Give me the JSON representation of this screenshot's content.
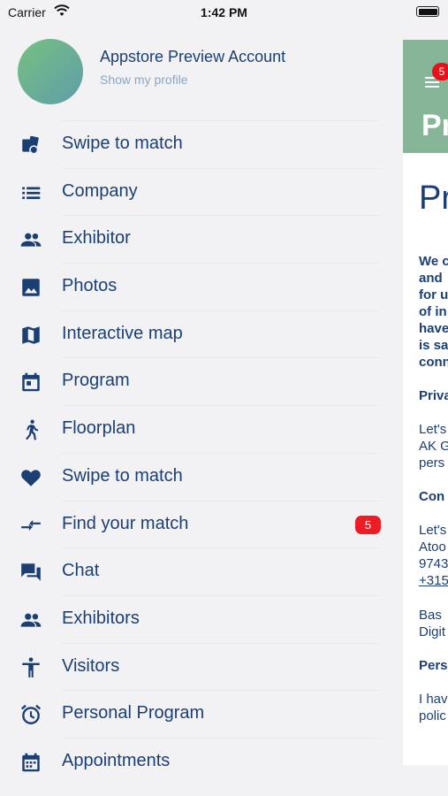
{
  "status_bar": {
    "carrier": "Carrier",
    "time": "1:42 PM"
  },
  "profile": {
    "name": "Appstore Preview Account",
    "subtitle": "Show my profile"
  },
  "menu": {
    "items": [
      {
        "label": "Swipe to match",
        "icon": "swipe-cards-icon"
      },
      {
        "label": "Company",
        "icon": "list-icon"
      },
      {
        "label": "Exhibitor",
        "icon": "people-icon"
      },
      {
        "label": "Photos",
        "icon": "photo-icon"
      },
      {
        "label": "Interactive map",
        "icon": "map-icon"
      },
      {
        "label": "Program",
        "icon": "calendar-icon"
      },
      {
        "label": "Floorplan",
        "icon": "walking-person-icon"
      },
      {
        "label": "Swipe to match",
        "icon": "heart-icon"
      },
      {
        "label": "Find your match",
        "icon": "compare-arrows-icon",
        "badge": "5"
      },
      {
        "label": "Chat",
        "icon": "chat-icon"
      },
      {
        "label": "Exhibitors",
        "icon": "people-icon"
      },
      {
        "label": "Visitors",
        "icon": "accessibility-icon"
      },
      {
        "label": "Personal Program",
        "icon": "alarm-icon"
      },
      {
        "label": "Appointments",
        "icon": "calendar-grid-icon"
      }
    ]
  },
  "peek_screen": {
    "badge": "5",
    "header_title": "Pr",
    "page_title": "Pr",
    "intro_lines": [
      "We c",
      "and",
      "for u",
      "of in",
      "have",
      "is sa",
      "conn"
    ],
    "heading_1": "Priva",
    "para_1": [
      "Let's",
      "AK G",
      "pers"
    ],
    "heading_2": "Con",
    "para_2": [
      "Let's",
      "Atoo",
      "9743"
    ],
    "para_2_link": "+315",
    "para_3": [
      "Bas",
      "Digit"
    ],
    "heading_3": "Pers",
    "para_4": [
      "I hav",
      "polic"
    ]
  },
  "colors": {
    "brand_text": "#1b3f73",
    "header_green": "#86b597",
    "badge_red": "#ee1c25"
  }
}
